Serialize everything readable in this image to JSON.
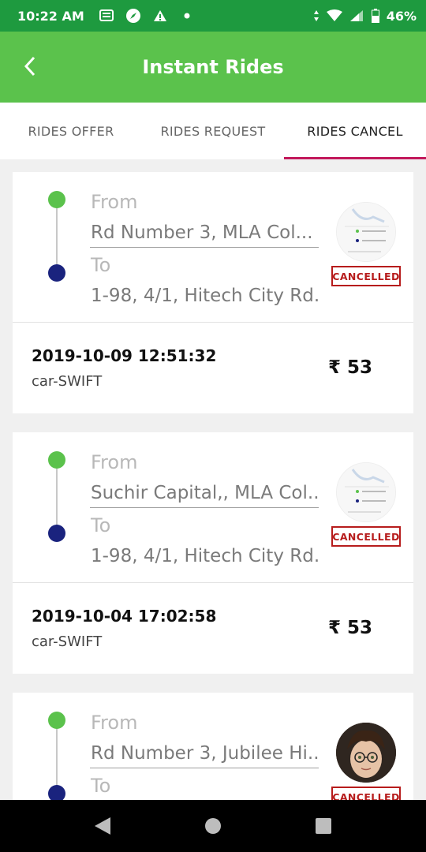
{
  "status_bar": {
    "time": "10:22 AM",
    "battery": "46%",
    "left_icons": [
      "message-icon",
      "compass-icon",
      "alert-icon",
      "dot-icon"
    ],
    "right_icons": [
      "data-arrows-icon",
      "wifi-icon",
      "signal-icon",
      "battery-icon"
    ]
  },
  "app_bar": {
    "title": "Instant Rides",
    "back_icon": "chevron-left-icon",
    "color": "#5bc24c"
  },
  "tabs": [
    {
      "label": "RIDES OFFER",
      "active": false
    },
    {
      "label": "RIDES REQUEST",
      "active": false
    },
    {
      "label": "RIDES CANCEL",
      "active": true
    }
  ],
  "colors": {
    "accent_tab": "#c2185b",
    "from_dot": "#5bc24c",
    "to_dot": "#1a237e",
    "stamp": "#b71c1c"
  },
  "rides": [
    {
      "from_label": "From",
      "from_address": "Rd Number 3, MLA Col...",
      "to_label": "To",
      "to_address": "1-98, 4/1, Hitech City Rd...",
      "status": "CANCELLED",
      "datetime": "2019-10-09 12:51:32",
      "car": "car-SWIFT",
      "price": "₹ 53",
      "thumbnail": "map-thumbnail"
    },
    {
      "from_label": "From",
      "from_address": "Suchir Capital,, MLA Col...",
      "to_label": "To",
      "to_address": "1-98, 4/1, Hitech City Rd...",
      "status": "CANCELLED",
      "datetime": "2019-10-04 17:02:58",
      "car": "car-SWIFT",
      "price": "₹ 53",
      "thumbnail": "map-thumbnail"
    },
    {
      "from_label": "From",
      "from_address": "Rd Number 3, Jubilee Hi...",
      "to_label": "To",
      "status": "CANCELLED",
      "thumbnail": "avatar-photo"
    }
  ],
  "nav_bar": [
    "back-triangle-icon",
    "home-circle-icon",
    "recents-square-icon"
  ]
}
